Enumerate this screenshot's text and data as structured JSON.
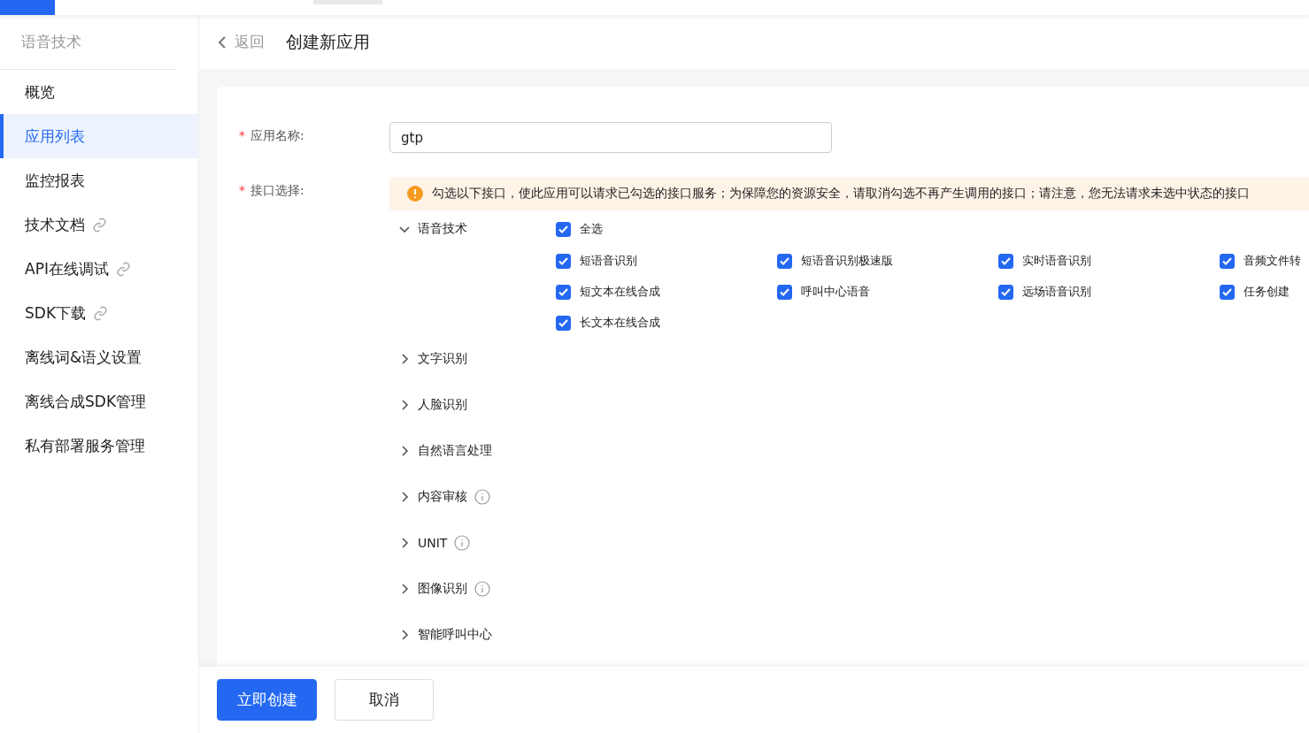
{
  "sidebar": {
    "title": "语音技术",
    "items": [
      {
        "label": "概览",
        "selected": false,
        "link": false
      },
      {
        "label": "应用列表",
        "selected": true,
        "link": false
      },
      {
        "label": "监控报表",
        "selected": false,
        "link": false
      },
      {
        "label": "技术文档",
        "selected": false,
        "link": true
      },
      {
        "label": "API在线调试",
        "selected": false,
        "link": true
      },
      {
        "label": "SDK下载",
        "selected": false,
        "link": true
      },
      {
        "label": "离线词&语义设置",
        "selected": false,
        "link": false
      },
      {
        "label": "离线合成SDK管理",
        "selected": false,
        "link": false
      },
      {
        "label": "私有部署服务管理",
        "selected": false,
        "link": false
      }
    ]
  },
  "header": {
    "back": "返回",
    "title": "创建新应用"
  },
  "form": {
    "required_mark": "*",
    "name_label": "应用名称:",
    "name_value": "gtp",
    "api_label": "接口选择:",
    "notice": "勾选以下接口，使此应用可以请求已勾选的接口服务；为保障您的资源安全，请取消勾选不再产生调用的接口；请注意，您无法请求未选中状态的接口",
    "groups": [
      {
        "label": "语音技术",
        "expanded": true,
        "info": false,
        "select_all": {
          "label": "全选",
          "checked": true
        },
        "items": [
          {
            "label": "短语音识别",
            "checked": true
          },
          {
            "label": "短语音识别极速版",
            "checked": true
          },
          {
            "label": "实时语音识别",
            "checked": true
          },
          {
            "label": "音频文件转",
            "checked": true
          },
          {
            "label": "短文本在线合成",
            "checked": true
          },
          {
            "label": "呼叫中心语音",
            "checked": true
          },
          {
            "label": "远场语音识别",
            "checked": true
          },
          {
            "label": "任务创建",
            "checked": true
          },
          {
            "label": "长文本在线合成",
            "checked": true
          }
        ]
      },
      {
        "label": "文字识别",
        "expanded": false,
        "info": false
      },
      {
        "label": "人脸识别",
        "expanded": false,
        "info": false
      },
      {
        "label": "自然语言处理",
        "expanded": false,
        "info": false
      },
      {
        "label": "内容审核",
        "expanded": false,
        "info": true
      },
      {
        "label": "UNIT",
        "expanded": false,
        "info": true
      },
      {
        "label": "图像识别",
        "expanded": false,
        "info": true
      },
      {
        "label": "智能呼叫中心",
        "expanded": false,
        "info": false
      }
    ]
  },
  "footer": {
    "buttons": [
      {
        "label": "立即创建",
        "kind": "primary"
      },
      {
        "label": "取消",
        "kind": "default"
      }
    ]
  }
}
